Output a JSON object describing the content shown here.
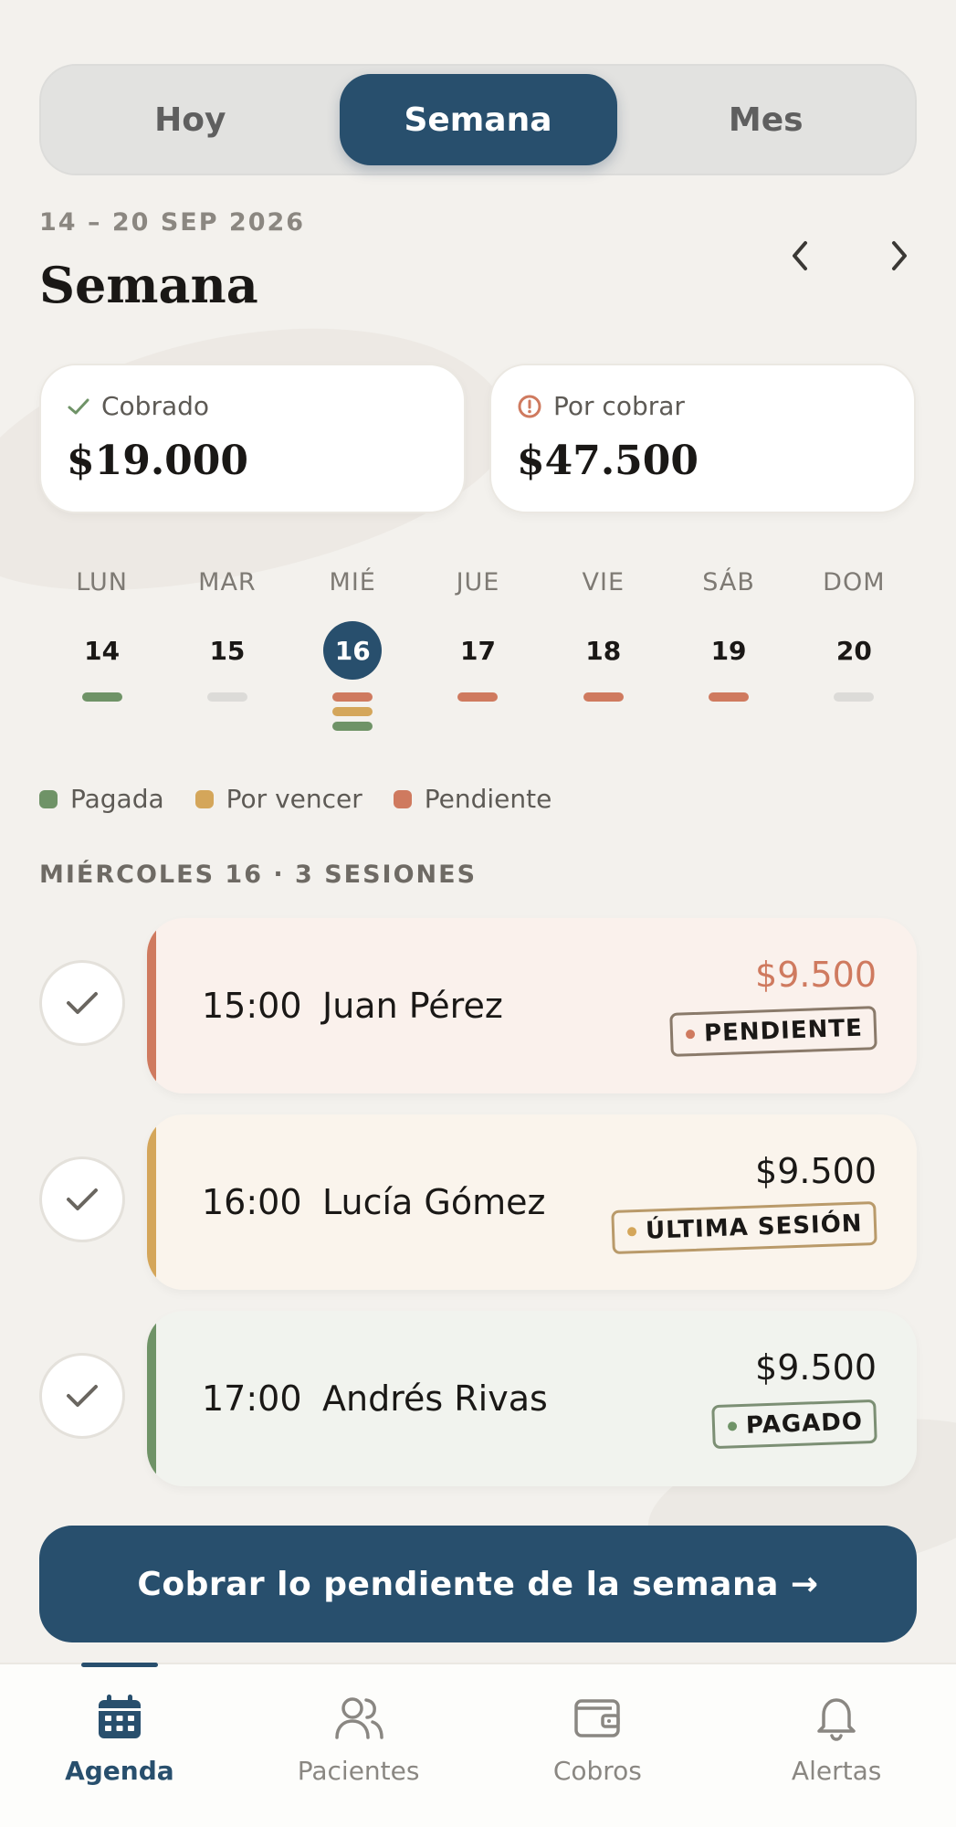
{
  "colors": {
    "primary": "#284f6d",
    "paid": "#6f9367",
    "due_soon": "#d4a65a",
    "pending": "#cf7a5f",
    "neutral": "#dcdbd8"
  },
  "segments": [
    {
      "label": "Hoy",
      "active": false
    },
    {
      "label": "Semana",
      "active": true
    },
    {
      "label": "Mes",
      "active": false
    }
  ],
  "header": {
    "date_range": "14 – 20 SEP 2026",
    "title": "Semana",
    "prev_icon": "chevron-left-icon",
    "next_icon": "chevron-right-icon"
  },
  "summary": {
    "collected": {
      "label": "Cobrado",
      "amount": "$19.000",
      "icon": "check-icon"
    },
    "to_collect": {
      "label": "Por cobrar",
      "amount": "$47.500",
      "icon": "alert-circle-icon"
    }
  },
  "week": [
    {
      "name": "LUN",
      "num": "14",
      "selected": false,
      "bars": [
        "paid"
      ]
    },
    {
      "name": "MAR",
      "num": "15",
      "selected": false,
      "bars": [
        "neutral"
      ]
    },
    {
      "name": "MIÉ",
      "num": "16",
      "selected": true,
      "bars": [
        "pending",
        "due_soon",
        "paid"
      ]
    },
    {
      "name": "JUE",
      "num": "17",
      "selected": false,
      "bars": [
        "pending"
      ]
    },
    {
      "name": "VIE",
      "num": "18",
      "selected": false,
      "bars": [
        "pending"
      ]
    },
    {
      "name": "SÁB",
      "num": "19",
      "selected": false,
      "bars": [
        "pending"
      ]
    },
    {
      "name": "DOM",
      "num": "20",
      "selected": false,
      "bars": [
        "neutral"
      ]
    }
  ],
  "legend": [
    {
      "label": "Pagada",
      "color": "#6f9367"
    },
    {
      "label": "Por vencer",
      "color": "#d4a65a"
    },
    {
      "label": "Pendiente",
      "color": "#cf7a5f"
    }
  ],
  "section_title": "MIÉRCOLES 16 · 3 SESIONES",
  "sessions": [
    {
      "time": "15:00",
      "name": "Juan Pérez",
      "amount": "$9.500",
      "badge": "PENDIENTE",
      "status": "pending",
      "bg": "#faf1ec",
      "amount_color": "#cf7a5f"
    },
    {
      "time": "16:00",
      "name": "Lucía Gómez",
      "amount": "$9.500",
      "badge": "ÚLTIMA SESIÓN",
      "status": "due_soon",
      "bg": "#faf4ec",
      "amount_color": "#1a1816"
    },
    {
      "time": "17:00",
      "name": "Andrés Rivas",
      "amount": "$9.500",
      "badge": "PAGADO",
      "status": "paid",
      "bg": "#f1f3ee",
      "amount_color": "#1a1816"
    }
  ],
  "cta": {
    "label": "Cobrar lo pendiente de la semana →"
  },
  "tabs": [
    {
      "label": "Agenda",
      "icon": "calendar-icon",
      "active": true
    },
    {
      "label": "Pacientes",
      "icon": "users-icon",
      "active": false
    },
    {
      "label": "Cobros",
      "icon": "wallet-icon",
      "active": false
    },
    {
      "label": "Alertas",
      "icon": "bell-icon",
      "active": false
    }
  ]
}
